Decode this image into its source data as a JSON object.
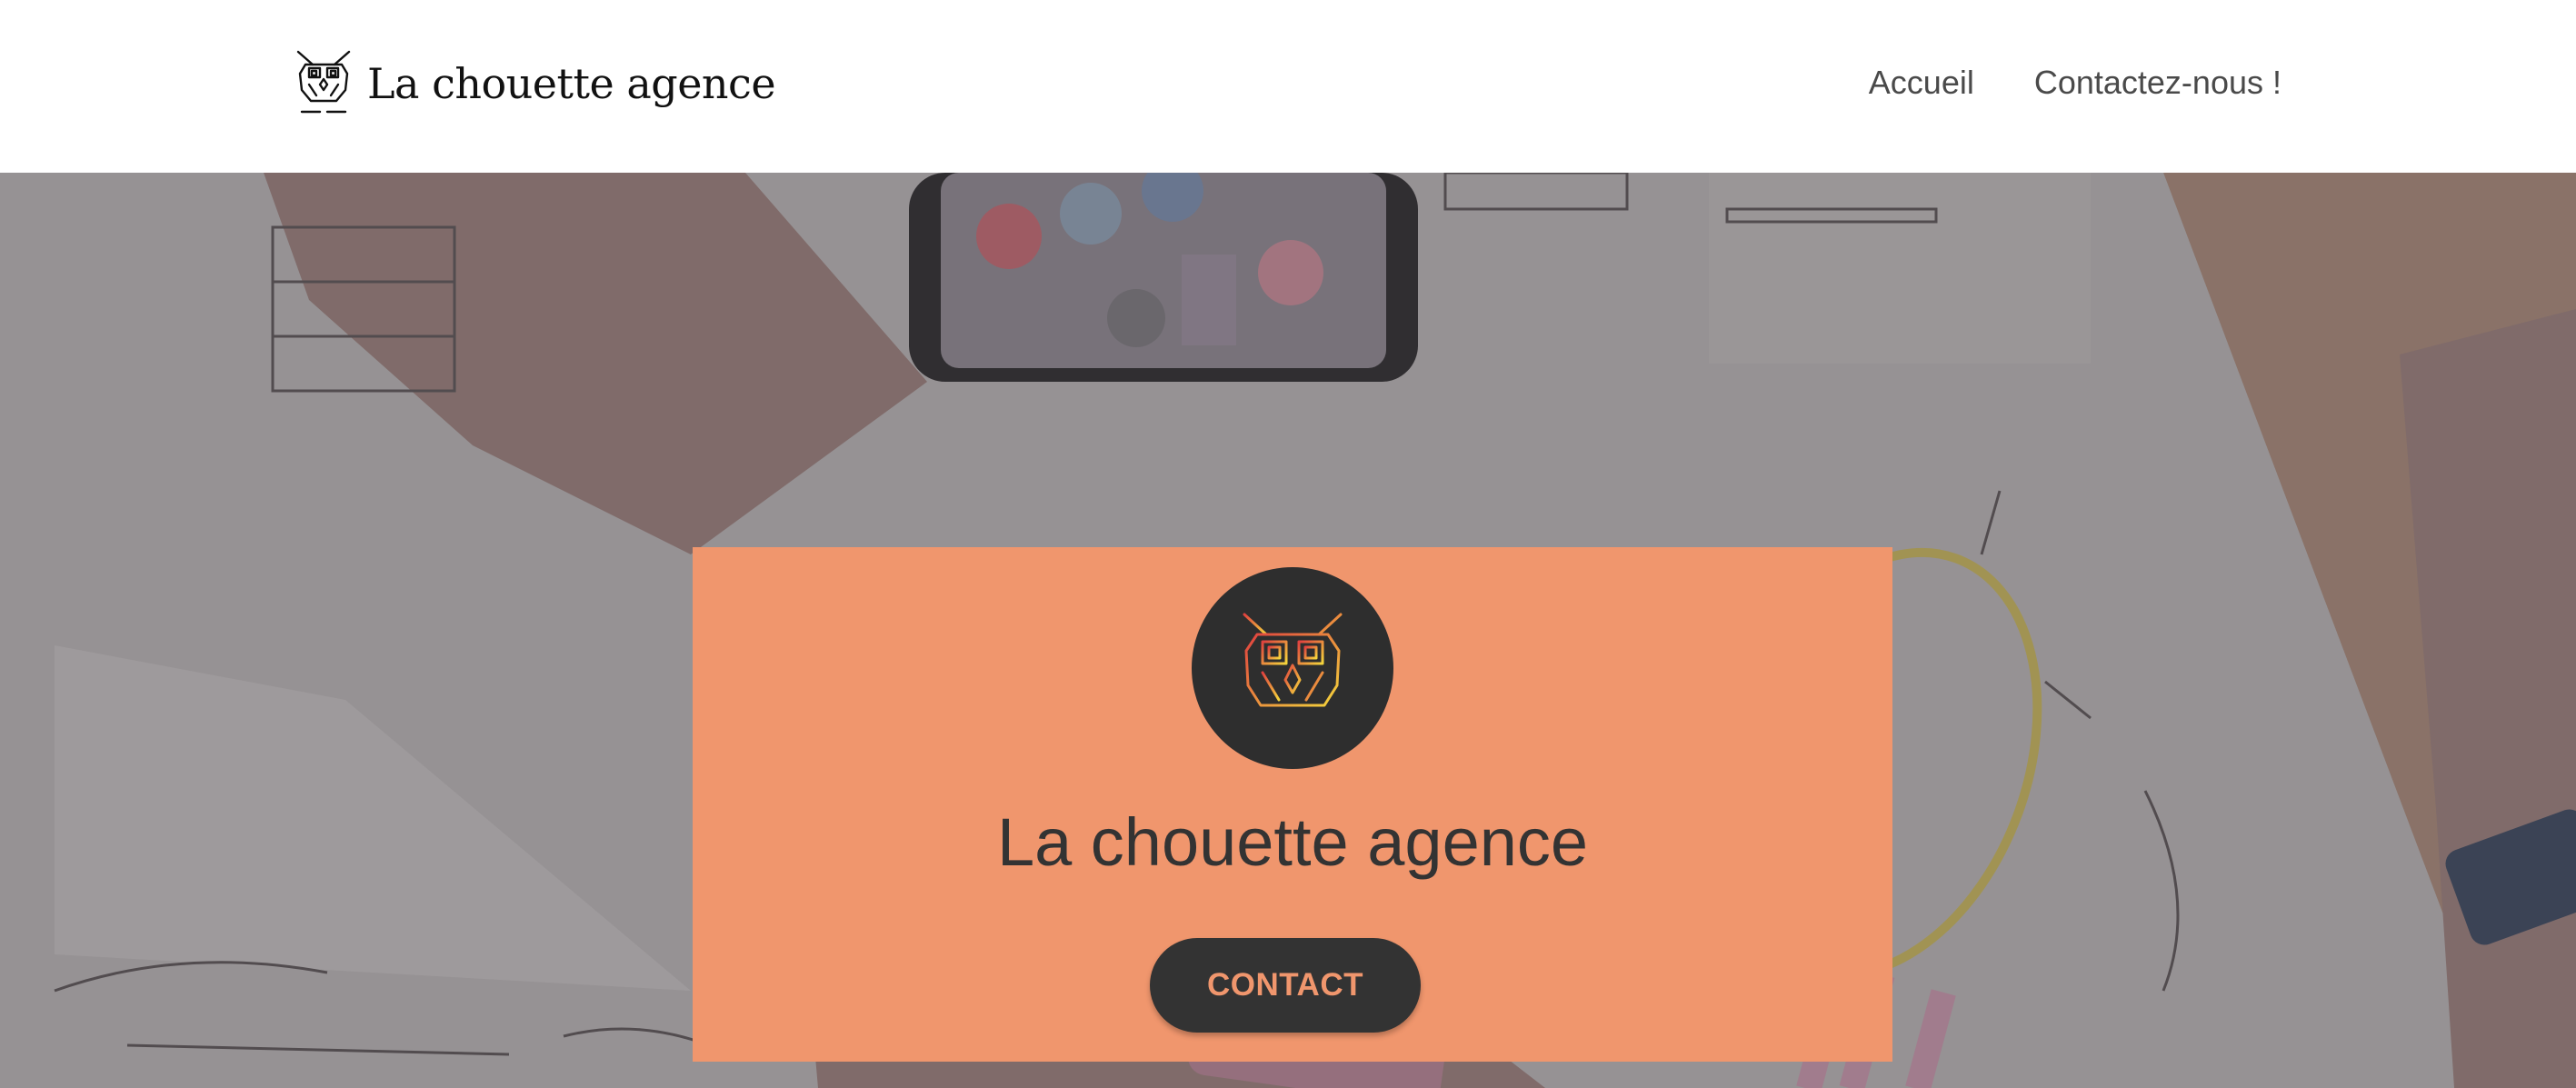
{
  "header": {
    "brand_name": "La chouette agence",
    "logo_icon": "owl-icon",
    "nav": [
      {
        "label": "Accueil"
      },
      {
        "label": "Contactez-nous !"
      }
    ]
  },
  "hero": {
    "background": "photo of people sketching app wireframes on paper with a smartphone",
    "card": {
      "logo_icon": "owl-icon",
      "title": "La chouette agence",
      "button_label": "CONTACT"
    }
  },
  "colors": {
    "accent": "#f0966d",
    "dark": "#333333",
    "owl_gradient_start": "#e0413f",
    "owl_gradient_end": "#f4d53c",
    "header_bg": "#ffffff",
    "nav_text": "#4a4a4a"
  }
}
